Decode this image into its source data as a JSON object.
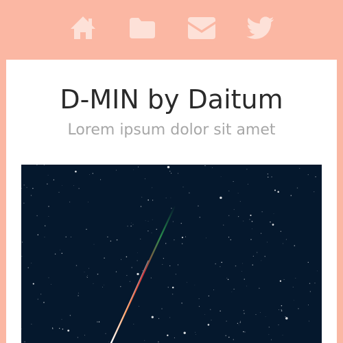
{
  "theme": {
    "background": "#fbb7a3",
    "nav_icon_color": "#fde1d8",
    "card_background": "#ffffff",
    "title_color": "#2a2a2a",
    "subtitle_color": "#a7a7a7",
    "sky_color": "#05182d",
    "meteor_colors": [
      "#ffffff",
      "#fe8d47",
      "#c8313a",
      "#2fa653"
    ]
  },
  "nav": {
    "items": [
      {
        "icon": "home-icon"
      },
      {
        "icon": "folder-icon"
      },
      {
        "icon": "mail-icon"
      },
      {
        "icon": "twitter-icon"
      }
    ]
  },
  "header": {
    "title": "D-MIN by Daitum",
    "subtitle": "Lorem ipsum dolor sit amet"
  },
  "hero": {
    "subject": "meteor streaking across a starry night sky"
  }
}
